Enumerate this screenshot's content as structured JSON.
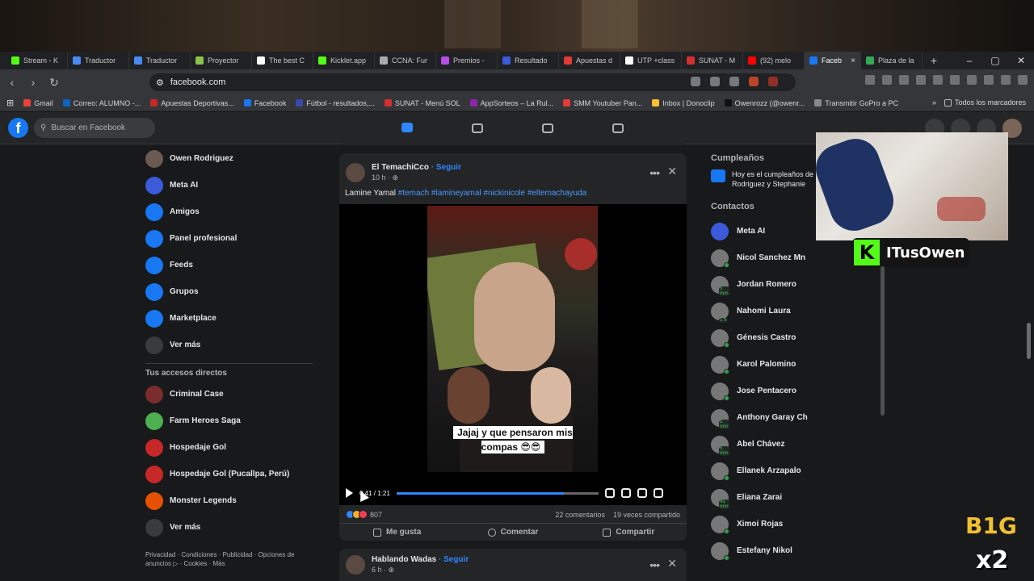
{
  "browser": {
    "tabs": [
      {
        "label": "Stream - K",
        "color": "#53fc18"
      },
      {
        "label": "Traductor",
        "color": "#4a8af4"
      },
      {
        "label": "Traductor",
        "color": "#4a8af4"
      },
      {
        "label": "Proyector",
        "color": "#8bc34a"
      },
      {
        "label": "The best C",
        "color": "#ffffff"
      },
      {
        "label": "Kicklet.app",
        "color": "#53fc18"
      },
      {
        "label": "CCNA: Fur",
        "color": "#aaaaaa"
      },
      {
        "label": "Premios -",
        "color": "#b84de8"
      },
      {
        "label": "Resultado",
        "color": "#3b5bdb"
      },
      {
        "label": "Apuestas d",
        "color": "#e53935"
      },
      {
        "label": "UTP +class",
        "color": "#ffffff"
      },
      {
        "label": "SUNAT - M",
        "color": "#d32f2f"
      },
      {
        "label": "(92) melo",
        "color": "#ff0000"
      }
    ],
    "active_tab": {
      "label": "Faceb",
      "close": "×"
    },
    "tab_after": {
      "label": "Plaza de la",
      "color": "#34a853"
    },
    "new_tab": "+",
    "window_controls": [
      "–",
      "▢",
      "✕"
    ],
    "url": "facebook.com"
  },
  "bookmarks": [
    {
      "label": "Gmail",
      "color": "#ea4335"
    },
    {
      "label": "Correo: ALUMNO -...",
      "color": "#0a66c2"
    },
    {
      "label": "Apuestas Deportivas...",
      "color": "#c62828"
    },
    {
      "label": "Facebook",
      "color": "#1877f2"
    },
    {
      "label": "Fútbol - resultados,...",
      "color": "#3949ab"
    },
    {
      "label": "SUNAT - Menú SOL",
      "color": "#d32f2f"
    },
    {
      "label": "AppSorteos – La Rul...",
      "color": "#8e24aa"
    },
    {
      "label": "SMM Youtuber Pan...",
      "color": "#e53935"
    },
    {
      "label": "Inbox | Donoclip",
      "color": "#fbc02d"
    },
    {
      "label": "Owenrozz (@owenr...",
      "color": "#111111"
    },
    {
      "label": "Transmitir GoPro a PC",
      "color": "#888888"
    }
  ],
  "bookmarks_more": "»",
  "bookmarks_all": "Todos los marcadores",
  "fb": {
    "logo": "f",
    "search_placeholder": "Buscar en Facebook",
    "left_menu": [
      {
        "label": "Owen Rodriguez",
        "color": "#6b5a52"
      },
      {
        "label": "Meta AI",
        "color": "#3b5bdb"
      },
      {
        "label": "Amigos",
        "color": "#1877f2"
      },
      {
        "label": "Panel profesional",
        "color": "#1877f2"
      },
      {
        "label": "Feeds",
        "color": "#1877f2"
      },
      {
        "label": "Grupos",
        "color": "#1877f2"
      },
      {
        "label": "Marketplace",
        "color": "#1877f2"
      },
      {
        "label": "Ver más",
        "color": "#3a3b3c"
      }
    ],
    "shortcuts_title": "Tus accesos directos",
    "shortcuts": [
      {
        "label": "Criminal Case",
        "color": "#7b2d2d"
      },
      {
        "label": "Farm Heroes Saga",
        "color": "#4caf50"
      },
      {
        "label": "Hospedaje Gol",
        "color": "#c62828"
      },
      {
        "label": "Hospedaje Gol (Pucallpa, Perú)",
        "color": "#c62828"
      },
      {
        "label": "Monster Legends",
        "color": "#e65100"
      },
      {
        "label": "Ver más",
        "color": "#3a3b3c"
      }
    ],
    "footer": "Privacidad · Condiciones · Publicidad · Opciones de anuncios ▷ · Cookies · Más",
    "post": {
      "author": "El TemachiCco",
      "follow": " · Seguir",
      "time": "10 h · ⊕",
      "text_plain": "Lamine Yamal ",
      "hashtags": "#temach #lamineyamal #nickinicole #eltemachayuda",
      "caption": "Jajaj y que pensaron mis compas 😎😎",
      "video_time": "0:41 / 1:21",
      "progress": 0.83,
      "reactions": "807",
      "comments": "22 comentarios",
      "shares": "19 veces compartido",
      "like": "Me gusta",
      "comment": "Comentar",
      "share": "Compartir"
    },
    "post2": {
      "author": "Hablando Wadas",
      "follow": " · Seguir",
      "time": "6 h · ⊕"
    },
    "birthdays_title": "Cumpleaños",
    "birthdays_text": "Hoy es el cumpleaños de Rodriguez y Stephanie",
    "contacts_title": "Contactos",
    "contacts": [
      {
        "name": "Meta AI",
        "badge": ""
      },
      {
        "name": "Nicol Sanchez Mn",
        "badge": ""
      },
      {
        "name": "Jordan Romero",
        "badge": "5 min"
      },
      {
        "name": "Nahomi Laura",
        "badge": "1 h"
      },
      {
        "name": "Génesis Castro",
        "badge": ""
      },
      {
        "name": "Karol Palomino",
        "badge": ""
      },
      {
        "name": "Jose Pentacero",
        "badge": ""
      },
      {
        "name": "Anthony Garay Ch",
        "badge": "5 min"
      },
      {
        "name": "Abel Chávez",
        "badge": "5 min"
      },
      {
        "name": "Ellanek Arzapalo",
        "badge": ""
      },
      {
        "name": "Eliana Zarai",
        "badge": "45 min"
      },
      {
        "name": "Ximoi Rojas",
        "badge": ""
      },
      {
        "name": "Estefany Nikol",
        "badge": ""
      }
    ]
  },
  "overlay": {
    "kick_letter": "K",
    "kick_name": "ITusOwen",
    "watermark_top": "B1G",
    "watermark_bottom": "x2"
  }
}
